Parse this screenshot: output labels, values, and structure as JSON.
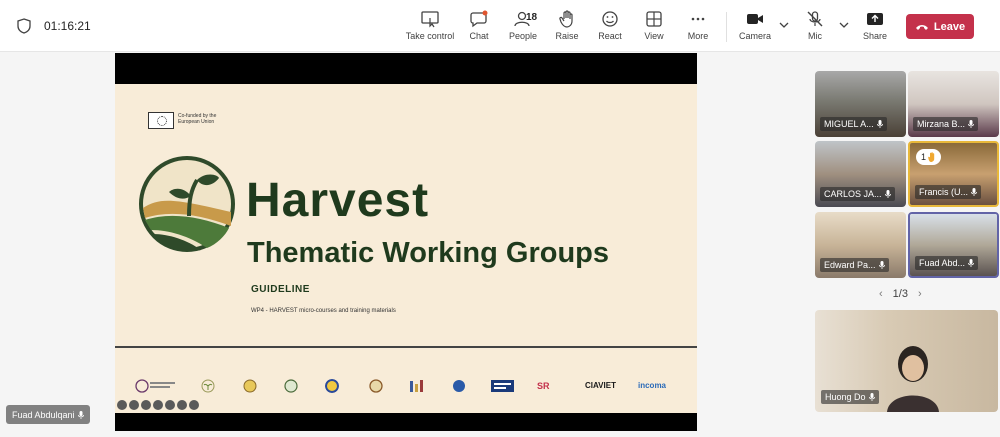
{
  "meeting": {
    "timer": "01:16:21"
  },
  "toolbar": {
    "take_control": "Take control",
    "chat": "Chat",
    "people": "People",
    "people_count": "18",
    "raise": "Raise",
    "react": "React",
    "view": "View",
    "more": "More",
    "camera": "Camera",
    "mic": "Mic",
    "share": "Share",
    "leave": "Leave"
  },
  "slide": {
    "eu_text": "Co-funded by the European Union",
    "title": "Harvest",
    "subtitle": "Thematic Working Groups",
    "guideline": "GUIDELINE",
    "wp4": "WP4  -  HARVEST micro-courses and training materials",
    "partners": [
      "SR",
      "CIAVIET",
      "incoma"
    ]
  },
  "presenter": {
    "name": "Fuad Abdulqani"
  },
  "participants": [
    {
      "name": "MIGUEL A..."
    },
    {
      "name": "Mirzana B..."
    },
    {
      "name": "CARLOS JA..."
    },
    {
      "name": "Francis (U..."
    },
    {
      "name": "Edward Pa..."
    },
    {
      "name": "Fuad Abd..."
    }
  ],
  "raised_hand_count": "1",
  "pager": {
    "label": "1/3"
  },
  "featured": {
    "name": "Huong Do"
  },
  "colors": {
    "leave": "#c4314b",
    "slide_bg": "#f8ecd8",
    "slide_title": "#1f3a1d",
    "active_speaker": "#e8b83a",
    "selected": "#6264a7"
  }
}
